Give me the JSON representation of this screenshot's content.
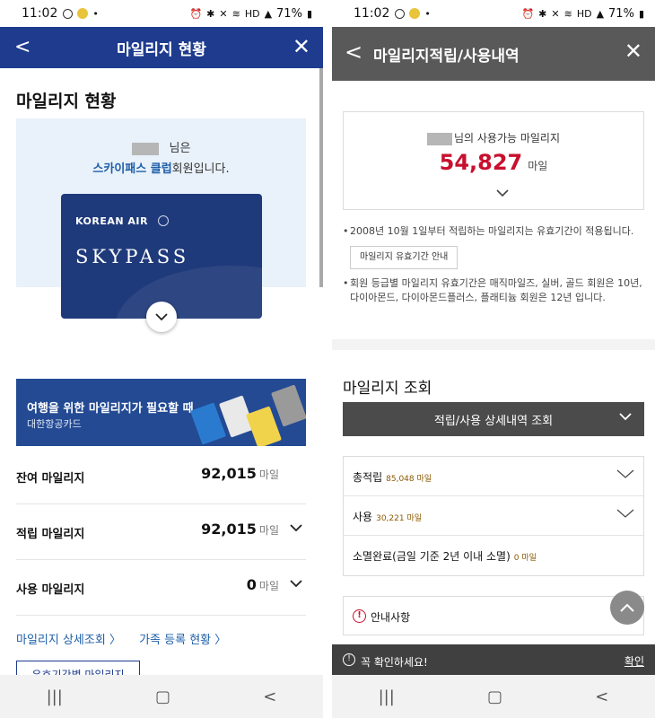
{
  "status": {
    "time": "11:02",
    "battery": "71%",
    "network": "HD"
  },
  "left": {
    "header": {
      "title": "마일리지 현황"
    },
    "section_title": "마일리지 현황",
    "member": {
      "suffix": "님은",
      "club": "스카이패스 클럽",
      "club_suffix": "회원입니다."
    },
    "card": {
      "brand": "KOREAN AIR",
      "name": "SKYPASS"
    },
    "banner": {
      "title": "여행을 위한 마일리지가 필요할 때",
      "subtitle": "대한항공카드"
    },
    "rows": [
      {
        "label": "잔여 마일리지",
        "value": "92,015",
        "unit": "마일"
      },
      {
        "label": "적립 마일리지",
        "value": "92,015",
        "unit": "마일"
      },
      {
        "label": "사용 마일리지",
        "value": "0",
        "unit": "마일"
      }
    ],
    "links": [
      "마일리지 상세조회 〉",
      "가족 등록 현황 〉"
    ],
    "outline_button": "유효기간별 마일리지"
  },
  "right": {
    "header": {
      "title": "마일리지적립/사용내역"
    },
    "summary": {
      "suffix": "님의 사용가능 마일리지",
      "amount": "54,827",
      "unit": "마일"
    },
    "notes": [
      "2008년 10월 1일부터 적립하는 마일리지는 유효기간이 적용됩니다.",
      "회원 등급별 마일리지 유효기간은 매직마일즈, 실버, 골드 회원은 10년, 다이아몬드, 다이아몬드플러스, 플래티늄 회원은 12년 입니다."
    ],
    "validity_button": "마일리지 유효기간 안내",
    "section_title": "마일리지 조회",
    "select_label": "적립/사용 상세내역 조회",
    "items": [
      {
        "label": "총적립",
        "sub": "85,048 마일"
      },
      {
        "label": "사용",
        "sub": "30,221 마일"
      },
      {
        "label": "소멸완료(금일 기준 2년 이내 소멸)",
        "sub": "0 마일"
      }
    ],
    "info_label": "안내사항",
    "toast": {
      "message": "꼭 확인하세요!",
      "confirm": "확인"
    }
  },
  "colors": {
    "left_header": "#1e3b8e",
    "right_header": "#595959",
    "accent_red": "#c8102e"
  }
}
